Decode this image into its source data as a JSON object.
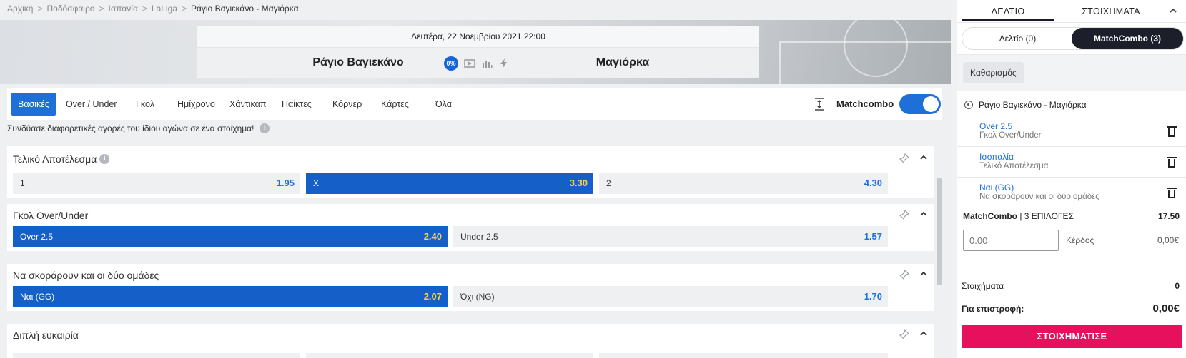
{
  "breadcrumb": [
    "Αρχική",
    "Ποδόσφαιρο",
    "Ισπανία",
    "LaLiga",
    "Ράγιο Βαγιεκάνο - Μαγιόρκα"
  ],
  "breadcrumb_separator": ">",
  "match": {
    "date": "Δευτέρα, 22 Νοεμβρίου 2021 22:00",
    "home": "Ράγιο Βαγιεκάνο",
    "away": "Μαγιόρκα",
    "payout_badge": "0%"
  },
  "tabs": [
    "Βασικές",
    "Over / Under",
    "Γκολ",
    "Ημίχρονο",
    "Χάντικαπ",
    "Παίκτες",
    "Κόρνερ",
    "Κάρτες",
    "Όλα"
  ],
  "matchcombo_label": "Matchcombo",
  "hint": "Συνδύασε διαφορετικές αγορές του ίδιου αγώνα σε ένα στοίχημα!",
  "info_glyph": "i",
  "markets": [
    {
      "title": "Τελικό Αποτέλεσμα",
      "odds": [
        {
          "label": "1",
          "value": "1.95",
          "selected": false
        },
        {
          "label": "X",
          "value": "3.30",
          "selected": true
        },
        {
          "label": "2",
          "value": "4.30",
          "selected": false
        }
      ]
    },
    {
      "title": "Γκολ Over/Under",
      "odds": [
        {
          "label": "Over 2.5",
          "value": "2.40",
          "selected": true
        },
        {
          "label": "Under 2.5",
          "value": "1.57",
          "selected": false
        }
      ]
    },
    {
      "title": "Να σκοράρουν και οι δύο ομάδες",
      "odds": [
        {
          "label": "Ναι (GG)",
          "value": "2.07",
          "selected": true
        },
        {
          "label": "Όχι (NG)",
          "value": "1.70",
          "selected": false
        }
      ]
    },
    {
      "title": "Διπλή ευκαιρία",
      "odds": []
    }
  ],
  "colors": {
    "accent": "#1e70d8",
    "selected": "#1460c8",
    "selected_odds": "#f6d54a",
    "bet_button": "#e6105d",
    "dark": "#1c1f2a"
  },
  "slip": {
    "tabs": [
      "ΔΕΛΤΙΟ",
      "ΣΤΟΙΧΗΜΑΤΑ"
    ],
    "collapse_glyph": "^",
    "segments": [
      "Δελτίο (0)",
      "MatchCombo (3)"
    ],
    "clear_label": "Καθαρισμός",
    "event": "Ράγιο Βαγιεκάνο - Μαγιόρκα",
    "selections": [
      {
        "name": "Over 2.5",
        "market": "Γκολ Over/Under"
      },
      {
        "name": "Ισοπαλία",
        "market": "Τελικό Αποτέλεσμα"
      },
      {
        "name": "Ναι (GG)",
        "market": "Να σκοράρουν και οι δύο ομάδες"
      }
    ],
    "combo_label": "MatchCombo",
    "combo_count": "| 3 ΕΠΙΛΟΓΕΣ",
    "combo_odds": "17.50",
    "stake_placeholder": "0.00",
    "profit_label": "Κέρδος",
    "profit_value": "0,00€",
    "bets_label": "Στοιχήματα",
    "bets_value": "0",
    "return_label": "Για επιστροφή:",
    "return_value": "0,00€",
    "bet_button": "ΣΤΟΙΧΗΜΑΤΙΣΕ"
  }
}
